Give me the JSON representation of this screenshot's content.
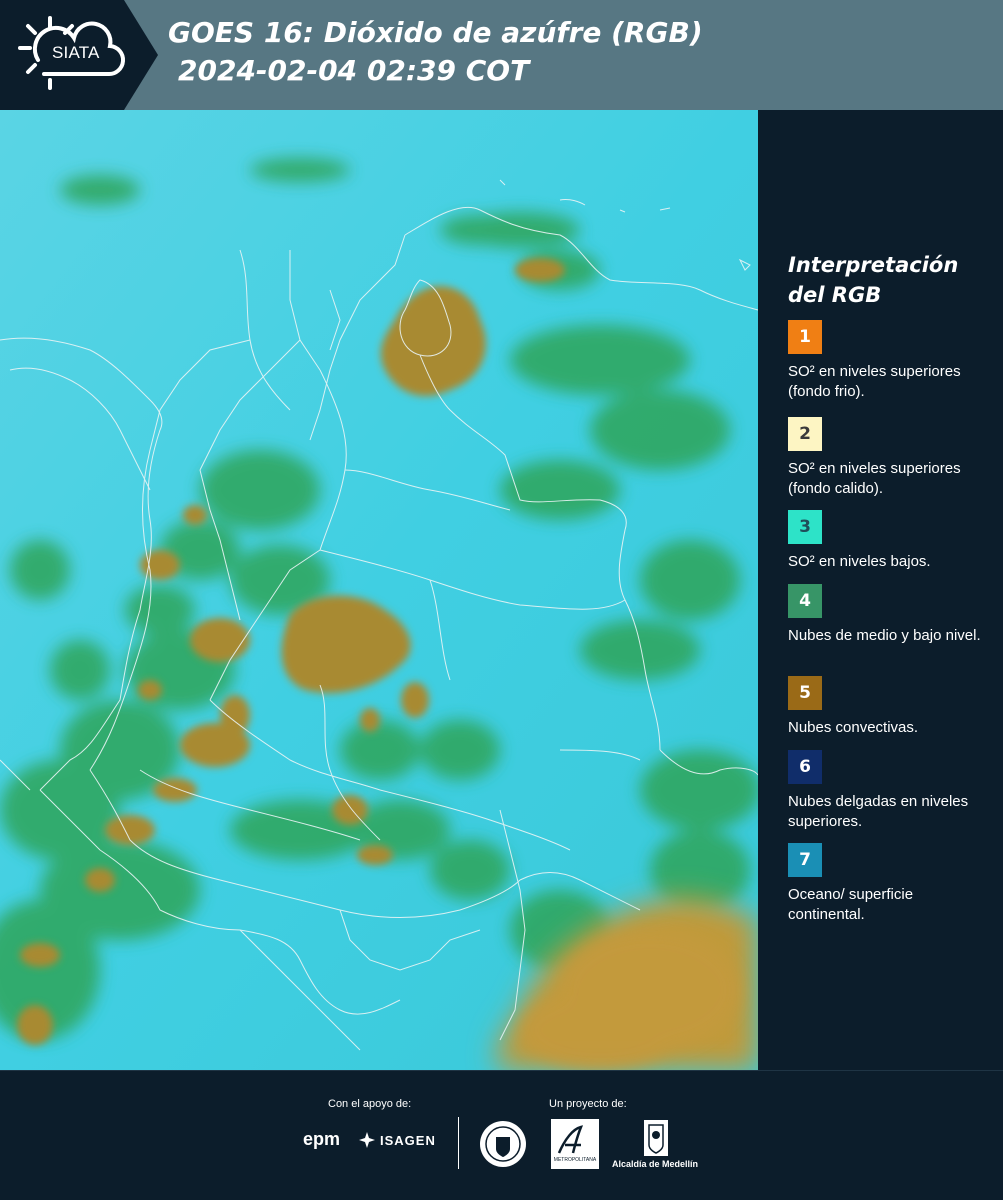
{
  "header": {
    "logo_text": "SIATA",
    "title_line1": "GOES 16: Dióxido de azúfre (RGB)",
    "title_line2": "2024-02-04 02:39 COT",
    "band_color": "#577783",
    "dark_color": "#0c1d2b"
  },
  "map": {
    "background_color": "#3ecfe0",
    "cloud_colors": [
      "#2fa55a",
      "#a0862e",
      "#c49a36",
      "#6ab85c"
    ],
    "border_color": "#e9f4f5"
  },
  "legend": {
    "title": "Interpretación del RGB",
    "items": [
      {
        "number": "1",
        "label": "SO² en niveles superiores (fondo frio).",
        "color": "#f07f14",
        "text_color": "#ffffff"
      },
      {
        "number": "2",
        "label": "SO² en niveles superiores (fondo calido).",
        "color": "#fdf5c3",
        "text_color": "#3a3a3a"
      },
      {
        "number": "3",
        "label": "SO² en niveles bajos.",
        "color": "#2de3c8",
        "text_color": "#1f4e5a"
      },
      {
        "number": "4",
        "label": "Nubes de medio y bajo nivel.",
        "color": "#379567",
        "text_color": "#ffffff"
      },
      {
        "number": "5",
        "label": "Nubes convectivas.",
        "color": "#9a6a17",
        "text_color": "#ffffff"
      },
      {
        "number": "6",
        "label": "Nubes delgadas en niveles superiores.",
        "color": "#102d6a",
        "text_color": "#ffffff"
      },
      {
        "number": "7",
        "label": "Oceano/ superficie continental.",
        "color": "#1a8fb5",
        "text_color": "#ffffff"
      }
    ]
  },
  "footer": {
    "support_label": "Con el apoyo de:",
    "project_label": "Un proyecto de:",
    "epm": "epm",
    "isagen": "ISAGEN",
    "metro_text": "METROPOLITANA",
    "alcaldia": "Alcaldía de Medellín"
  }
}
